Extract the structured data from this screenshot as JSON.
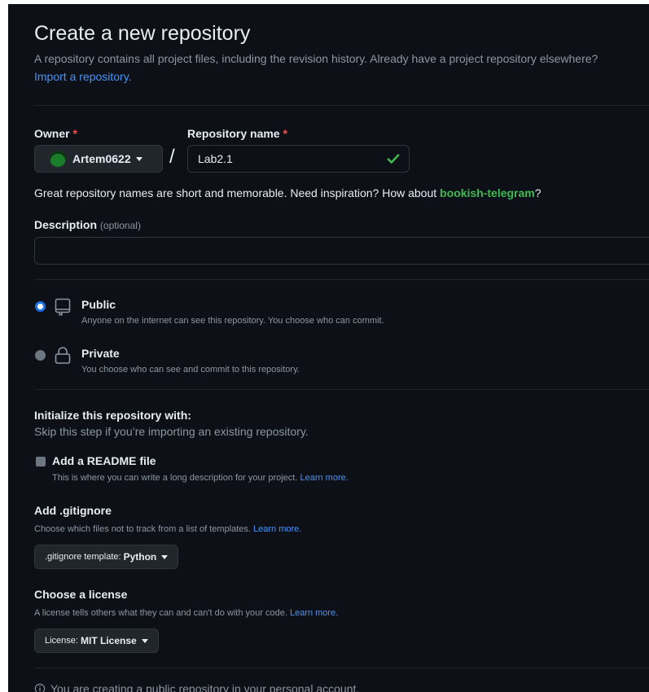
{
  "page": {
    "title": "Create a new repository",
    "subtitle": "A repository contains all project files, including the revision history. Already have a project repository elsewhere?",
    "import_link": "Import a repository."
  },
  "owner": {
    "label": "Owner",
    "required_mark": "*",
    "value": "Artem0622",
    "avatar_icon": "avatar-green-circle"
  },
  "separator": "/",
  "repo_name": {
    "label": "Repository name",
    "required_mark": "*",
    "value": "Lab2.1",
    "valid_icon": "check-icon",
    "valid_color": "#3fb950"
  },
  "name_hint": {
    "prefix": "Great repository names are short and memorable. Need inspiration? How about",
    "suggestion": "bookish-telegram",
    "suffix": "?"
  },
  "description": {
    "label": "Description",
    "optional": "(optional)",
    "value": ""
  },
  "visibility": {
    "selected": "public",
    "options": [
      {
        "id": "public",
        "title": "Public",
        "description": "Anyone on the internet can see this repository. You choose who can commit.",
        "icon": "repo-icon"
      },
      {
        "id": "private",
        "title": "Private",
        "description": "You choose who can see and commit to this repository.",
        "icon": "lock-icon"
      }
    ]
  },
  "initialize": {
    "title": "Initialize this repository with:",
    "subtitle": "Skip this step if you’re importing an existing repository.",
    "readme": {
      "label": "Add a README file",
      "checked": false,
      "description": "This is where you can write a long description for your project.",
      "learn_more": "Learn more."
    }
  },
  "gitignore": {
    "title": "Add .gitignore",
    "description": "Choose which files not to track from a list of templates.",
    "learn_more": "Learn more.",
    "select_prefix": ".gitignore template:",
    "select_value": "Python"
  },
  "license": {
    "title": "Choose a license",
    "description": "A license tells others what they can and can't do with your code.",
    "learn_more": "Learn more.",
    "select_prefix": "License:",
    "select_value": "MIT License"
  },
  "info": {
    "icon": "info-icon",
    "text": "You are creating a public repository in your personal account."
  },
  "colors": {
    "background": "#0d1117",
    "link": "#4493f8",
    "accent_green": "#3fb950",
    "required_red": "#f85149",
    "radio_selected": "#1f6feb"
  }
}
